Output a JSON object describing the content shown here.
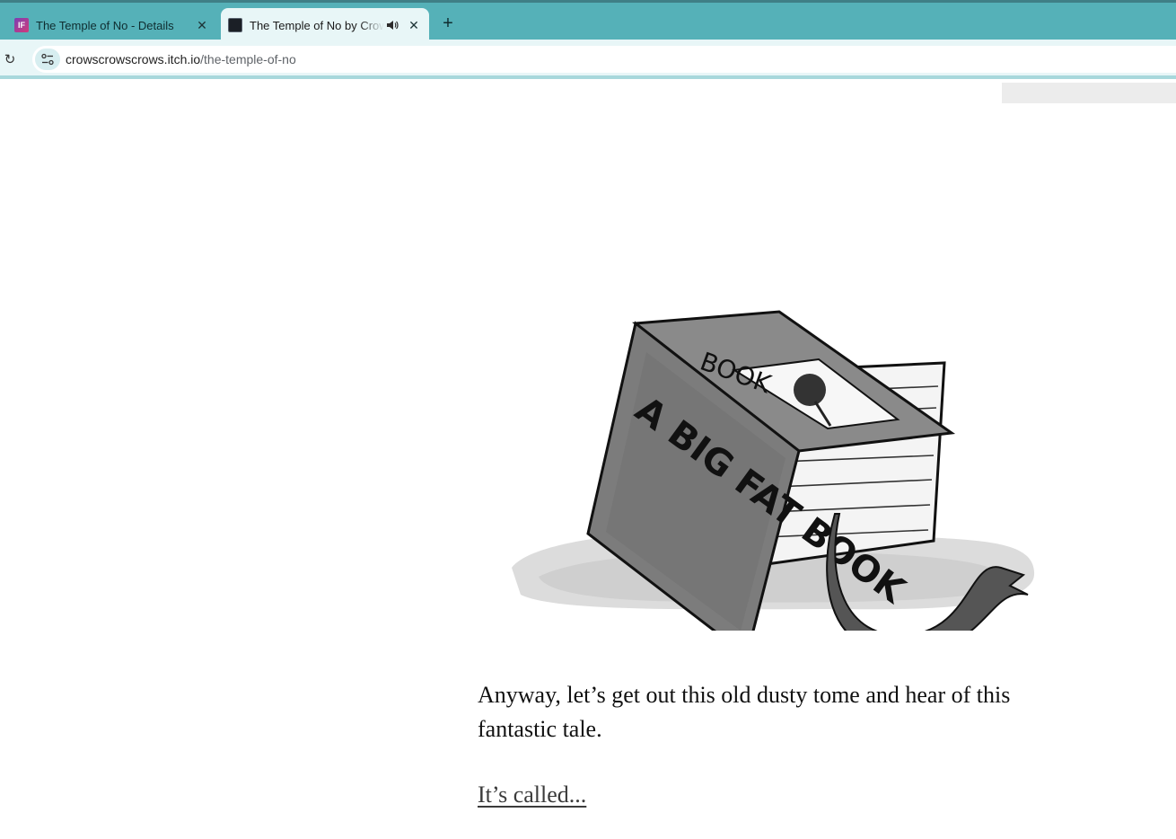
{
  "browser": {
    "tabs": [
      {
        "title": "The Temple of No - Details",
        "favicon": "IF",
        "active": false
      },
      {
        "title": "The Temple of No by Crows Crows Crows",
        "favicon": "game-icon",
        "active": true,
        "audio": "speaker-icon"
      }
    ],
    "new_tab_icon": "+",
    "close_icon": "✕",
    "reload_icon": "↻",
    "address": {
      "domain": "crowscrowscrows.itch.io",
      "path": "/the-temple-of-no"
    }
  },
  "page": {
    "illustration": {
      "cover_title": "A BIG FAT BOOK",
      "spine_title": "BOOK"
    },
    "story_text": "Anyway, let’s get out this old dusty tome and hear of this fantastic tale.",
    "link_text": "It’s called..."
  },
  "colors": {
    "tab_strip": "#55b1b8",
    "toolbar": "#e8f6f7"
  }
}
